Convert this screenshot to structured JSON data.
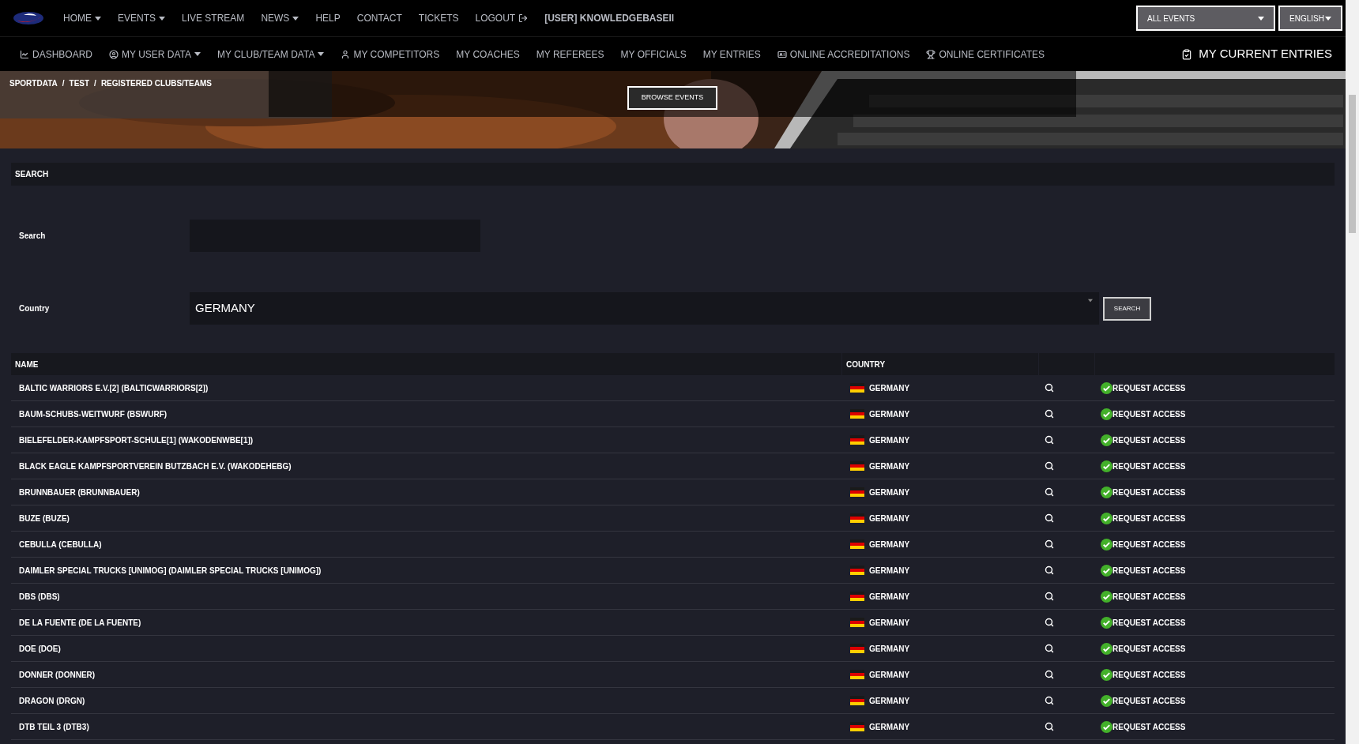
{
  "top_nav": {
    "items": [
      {
        "label": "HOME",
        "dropdown": true
      },
      {
        "label": "EVENTS",
        "dropdown": true
      },
      {
        "label": "LIVE STREAM",
        "dropdown": false
      },
      {
        "label": "NEWS",
        "dropdown": true
      },
      {
        "label": "HELP",
        "dropdown": false
      },
      {
        "label": "CONTACT",
        "dropdown": false
      },
      {
        "label": "TICKETS",
        "dropdown": false
      },
      {
        "label": "LOGOUT",
        "dropdown": false,
        "kind": "logout"
      }
    ],
    "user": "[USER] KNOWLEDGEBASEII",
    "event_select": "ALL EVENTS",
    "language_select": "ENGLISH"
  },
  "sub_nav": {
    "items": [
      {
        "label": "DASHBOARD",
        "kind": "chart",
        "dropdown": false
      },
      {
        "label": "MY USER DATA",
        "kind": "account",
        "dropdown": true
      },
      {
        "label": "MY CLUB/TEAM DATA",
        "dropdown": true
      },
      {
        "label": "MY COMPETITORS",
        "kind": "person",
        "dropdown": false
      },
      {
        "label": "MY COACHES",
        "dropdown": false
      },
      {
        "label": "MY REFEREES",
        "dropdown": false
      },
      {
        "label": "MY OFFICIALS",
        "dropdown": false
      },
      {
        "label": "MY ENTRIES",
        "dropdown": false
      },
      {
        "label": "ONLINE ACCREDITATIONS",
        "kind": "badge",
        "dropdown": false
      },
      {
        "label": "ONLINE CERTIFICATES",
        "kind": "award",
        "dropdown": false
      }
    ],
    "current_entries": "MY CURRENT ENTRIES"
  },
  "breadcrumb": {
    "items": [
      "SPORTDATA",
      "TEST",
      "REGISTERED CLUBS/TEAMS"
    ],
    "separator": "/"
  },
  "banner": {
    "button": "BROWSE EVENTS"
  },
  "search": {
    "title": "SEARCH",
    "fields": [
      {
        "label": "Search",
        "kind": "text"
      },
      {
        "label": "Country",
        "kind": "select",
        "value": "GERMANY"
      }
    ],
    "button": "SEARCH"
  },
  "table": {
    "columns": [
      "NAME",
      "COUNTRY"
    ],
    "rows": [
      {
        "name": "BALTIC WARRIORS E.V.[2] (BALTICWARRIORS[2])",
        "country": "GERMANY",
        "action": "REQUEST ACCESS"
      },
      {
        "name": "BAUM-SCHUBS-WEITWURF (BSWURF)",
        "country": "GERMANY",
        "action": "REQUEST ACCESS"
      },
      {
        "name": "BIELEFELDER-KAMPFSPORT-SCHULE[1] (WAKODENWBE[1])",
        "country": "GERMANY",
        "action": "REQUEST ACCESS"
      },
      {
        "name": "BLACK EAGLE KAMPFSPORTVEREIN BUTZBACH E.V. (WAKODEHEBG)",
        "country": "GERMANY",
        "action": "REQUEST ACCESS"
      },
      {
        "name": "BRUNNBAUER (BRUNNBAUER)",
        "country": "GERMANY",
        "action": "REQUEST ACCESS"
      },
      {
        "name": "BUZE (BUZE)",
        "country": "GERMANY",
        "action": "REQUEST ACCESS"
      },
      {
        "name": "CEBULLA (CEBULLA)",
        "country": "GERMANY",
        "action": "REQUEST ACCESS"
      },
      {
        "name": "DAIMLER SPECIAL TRUCKS [UNIMOG] (DAIMLER SPECIAL TRUCKS [UNIMOG])",
        "country": "GERMANY",
        "action": "REQUEST ACCESS"
      },
      {
        "name": "DBS (DBS)",
        "country": "GERMANY",
        "action": "REQUEST ACCESS"
      },
      {
        "name": "DE LA FUENTE (DE LA FUENTE)",
        "country": "GERMANY",
        "action": "REQUEST ACCESS"
      },
      {
        "name": "DOE (DOE)",
        "country": "GERMANY",
        "action": "REQUEST ACCESS"
      },
      {
        "name": "DONNER (DONNER)",
        "country": "GERMANY",
        "action": "REQUEST ACCESS"
      },
      {
        "name": "DRAGON (DRGN)",
        "country": "GERMANY",
        "action": "REQUEST ACCESS"
      },
      {
        "name": "DTB TEIL 3 (DTB3)",
        "country": "GERMANY",
        "action": "REQUEST ACCESS"
      }
    ]
  }
}
